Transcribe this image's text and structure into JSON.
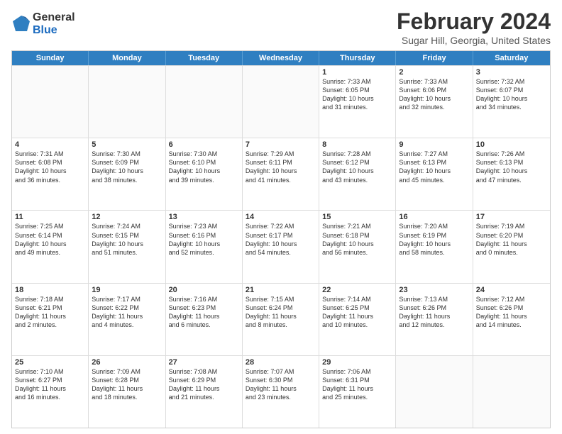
{
  "logo": {
    "general": "General",
    "blue": "Blue"
  },
  "title": "February 2024",
  "subtitle": "Sugar Hill, Georgia, United States",
  "header_days": [
    "Sunday",
    "Monday",
    "Tuesday",
    "Wednesday",
    "Thursday",
    "Friday",
    "Saturday"
  ],
  "rows": [
    [
      {
        "day": "",
        "empty": true
      },
      {
        "day": "",
        "empty": true
      },
      {
        "day": "",
        "empty": true
      },
      {
        "day": "",
        "empty": true
      },
      {
        "day": "1",
        "lines": [
          "Sunrise: 7:33 AM",
          "Sunset: 6:05 PM",
          "Daylight: 10 hours",
          "and 31 minutes."
        ]
      },
      {
        "day": "2",
        "lines": [
          "Sunrise: 7:33 AM",
          "Sunset: 6:06 PM",
          "Daylight: 10 hours",
          "and 32 minutes."
        ]
      },
      {
        "day": "3",
        "lines": [
          "Sunrise: 7:32 AM",
          "Sunset: 6:07 PM",
          "Daylight: 10 hours",
          "and 34 minutes."
        ]
      }
    ],
    [
      {
        "day": "4",
        "lines": [
          "Sunrise: 7:31 AM",
          "Sunset: 6:08 PM",
          "Daylight: 10 hours",
          "and 36 minutes."
        ]
      },
      {
        "day": "5",
        "lines": [
          "Sunrise: 7:30 AM",
          "Sunset: 6:09 PM",
          "Daylight: 10 hours",
          "and 38 minutes."
        ]
      },
      {
        "day": "6",
        "lines": [
          "Sunrise: 7:30 AM",
          "Sunset: 6:10 PM",
          "Daylight: 10 hours",
          "and 39 minutes."
        ]
      },
      {
        "day": "7",
        "lines": [
          "Sunrise: 7:29 AM",
          "Sunset: 6:11 PM",
          "Daylight: 10 hours",
          "and 41 minutes."
        ]
      },
      {
        "day": "8",
        "lines": [
          "Sunrise: 7:28 AM",
          "Sunset: 6:12 PM",
          "Daylight: 10 hours",
          "and 43 minutes."
        ]
      },
      {
        "day": "9",
        "lines": [
          "Sunrise: 7:27 AM",
          "Sunset: 6:13 PM",
          "Daylight: 10 hours",
          "and 45 minutes."
        ]
      },
      {
        "day": "10",
        "lines": [
          "Sunrise: 7:26 AM",
          "Sunset: 6:13 PM",
          "Daylight: 10 hours",
          "and 47 minutes."
        ]
      }
    ],
    [
      {
        "day": "11",
        "lines": [
          "Sunrise: 7:25 AM",
          "Sunset: 6:14 PM",
          "Daylight: 10 hours",
          "and 49 minutes."
        ]
      },
      {
        "day": "12",
        "lines": [
          "Sunrise: 7:24 AM",
          "Sunset: 6:15 PM",
          "Daylight: 10 hours",
          "and 51 minutes."
        ]
      },
      {
        "day": "13",
        "lines": [
          "Sunrise: 7:23 AM",
          "Sunset: 6:16 PM",
          "Daylight: 10 hours",
          "and 52 minutes."
        ]
      },
      {
        "day": "14",
        "lines": [
          "Sunrise: 7:22 AM",
          "Sunset: 6:17 PM",
          "Daylight: 10 hours",
          "and 54 minutes."
        ]
      },
      {
        "day": "15",
        "lines": [
          "Sunrise: 7:21 AM",
          "Sunset: 6:18 PM",
          "Daylight: 10 hours",
          "and 56 minutes."
        ]
      },
      {
        "day": "16",
        "lines": [
          "Sunrise: 7:20 AM",
          "Sunset: 6:19 PM",
          "Daylight: 10 hours",
          "and 58 minutes."
        ]
      },
      {
        "day": "17",
        "lines": [
          "Sunrise: 7:19 AM",
          "Sunset: 6:20 PM",
          "Daylight: 11 hours",
          "and 0 minutes."
        ]
      }
    ],
    [
      {
        "day": "18",
        "lines": [
          "Sunrise: 7:18 AM",
          "Sunset: 6:21 PM",
          "Daylight: 11 hours",
          "and 2 minutes."
        ]
      },
      {
        "day": "19",
        "lines": [
          "Sunrise: 7:17 AM",
          "Sunset: 6:22 PM",
          "Daylight: 11 hours",
          "and 4 minutes."
        ]
      },
      {
        "day": "20",
        "lines": [
          "Sunrise: 7:16 AM",
          "Sunset: 6:23 PM",
          "Daylight: 11 hours",
          "and 6 minutes."
        ]
      },
      {
        "day": "21",
        "lines": [
          "Sunrise: 7:15 AM",
          "Sunset: 6:24 PM",
          "Daylight: 11 hours",
          "and 8 minutes."
        ]
      },
      {
        "day": "22",
        "lines": [
          "Sunrise: 7:14 AM",
          "Sunset: 6:25 PM",
          "Daylight: 11 hours",
          "and 10 minutes."
        ]
      },
      {
        "day": "23",
        "lines": [
          "Sunrise: 7:13 AM",
          "Sunset: 6:26 PM",
          "Daylight: 11 hours",
          "and 12 minutes."
        ]
      },
      {
        "day": "24",
        "lines": [
          "Sunrise: 7:12 AM",
          "Sunset: 6:26 PM",
          "Daylight: 11 hours",
          "and 14 minutes."
        ]
      }
    ],
    [
      {
        "day": "25",
        "lines": [
          "Sunrise: 7:10 AM",
          "Sunset: 6:27 PM",
          "Daylight: 11 hours",
          "and 16 minutes."
        ]
      },
      {
        "day": "26",
        "lines": [
          "Sunrise: 7:09 AM",
          "Sunset: 6:28 PM",
          "Daylight: 11 hours",
          "and 18 minutes."
        ]
      },
      {
        "day": "27",
        "lines": [
          "Sunrise: 7:08 AM",
          "Sunset: 6:29 PM",
          "Daylight: 11 hours",
          "and 21 minutes."
        ]
      },
      {
        "day": "28",
        "lines": [
          "Sunrise: 7:07 AM",
          "Sunset: 6:30 PM",
          "Daylight: 11 hours",
          "and 23 minutes."
        ]
      },
      {
        "day": "29",
        "lines": [
          "Sunrise: 7:06 AM",
          "Sunset: 6:31 PM",
          "Daylight: 11 hours",
          "and 25 minutes."
        ]
      },
      {
        "day": "",
        "empty": true
      },
      {
        "day": "",
        "empty": true
      }
    ]
  ]
}
